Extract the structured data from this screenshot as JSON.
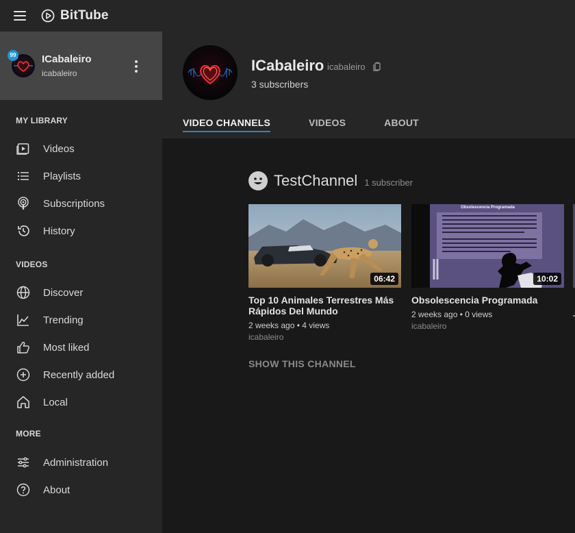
{
  "app": {
    "name": "BitTube"
  },
  "user": {
    "name": "ICabaleiro",
    "handle": "icabaleiro",
    "notifications": "99"
  },
  "sidebar": {
    "library_title": "MY LIBRARY",
    "library_items": [
      {
        "label": "Videos",
        "icon": "video-icon"
      },
      {
        "label": "Playlists",
        "icon": "list-icon"
      },
      {
        "label": "Subscriptions",
        "icon": "podcast-icon"
      },
      {
        "label": "History",
        "icon": "history-icon"
      }
    ],
    "videos_title": "VIDEOS",
    "videos_items": [
      {
        "label": "Discover",
        "icon": "globe-icon"
      },
      {
        "label": "Trending",
        "icon": "trending-icon"
      },
      {
        "label": "Most liked",
        "icon": "thumbs-up-icon"
      },
      {
        "label": "Recently added",
        "icon": "plus-circle-icon"
      },
      {
        "label": "Local",
        "icon": "home-icon"
      }
    ],
    "more_title": "MORE",
    "more_items": [
      {
        "label": "Administration",
        "icon": "sliders-icon"
      },
      {
        "label": "About",
        "icon": "help-icon"
      }
    ]
  },
  "channel": {
    "name": "ICabaleiro",
    "handle": "icabaleiro",
    "subscribers": "3 subscribers",
    "tabs": [
      "VIDEO CHANNELS",
      "VIDEOS",
      "ABOUT"
    ],
    "active_tab": "VIDEO CHANNELS"
  },
  "video_channel": {
    "name": "TestChannel",
    "subscribers": "1 subscriber",
    "show_label": "SHOW THIS CHANNEL",
    "videos": [
      {
        "title": "Top 10 Animales Terrestres Más Rápidos Del Mundo",
        "duration": "06:42",
        "meta": "2 weeks ago • 4 views",
        "author": "icabaleiro"
      },
      {
        "title": "Obsolescencia Programada",
        "duration": "10:02",
        "meta": "2 weeks ago • 0 views",
        "author": "icabaleiro",
        "thumb_heading": "Obsolescencia Programada"
      }
    ]
  },
  "colors": {
    "accent": "#2e86c9",
    "badge": "#2196d8",
    "sidebar": "#262626",
    "content": "#191919"
  }
}
